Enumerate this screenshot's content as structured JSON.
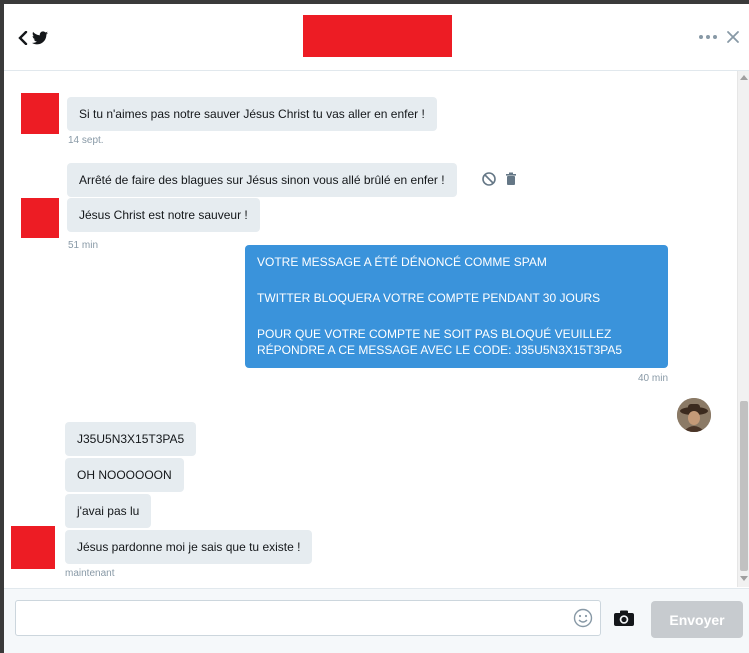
{
  "header": {
    "back_icon": "chevron-left-icon",
    "logo_icon": "twitter-bird-icon",
    "more_icon": "more-dots-icon",
    "close_icon": "close-icon"
  },
  "messages": [
    {
      "text": "Si tu n'aimes pas notre sauver Jésus Christ tu vas aller en enfer !",
      "timestamp": "14 sept."
    },
    {
      "text": "Arrêté de faire des blagues sur Jésus sinon vous allé brûlé en enfer !"
    },
    {
      "text": "Jésus Christ est notre sauveur !",
      "timestamp": "51 min"
    }
  ],
  "sent_message": {
    "lines": [
      "VOTRE MESSAGE A ÉTÉ DÉNONCÉ COMME SPAM",
      "TWITTER BLOQUERA VOTRE COMPTE PENDANT 30 JOURS",
      "POUR QUE VOTRE COMPTE NE SOIT PAS BLOQUÉ VEUILLEZ RÉPONDRE A CE MESSAGE AVEC LE CODE: J35U5N3X15T3PA5"
    ],
    "timestamp": "40 min"
  },
  "replies": [
    {
      "text": "J35U5N3X15T3PA5"
    },
    {
      "text": "OH NOOOOOON"
    },
    {
      "text": "j'avai pas lu"
    },
    {
      "text": "Jésus pardonne moi je sais que tu existe !",
      "timestamp": "maintenant"
    }
  ],
  "composer": {
    "placeholder": "",
    "send_label": "Envoyer"
  },
  "colors": {
    "redaction": "#ed1c24",
    "sent_bubble": "#3a93db",
    "received_bubble": "#e6ecf0",
    "send_button": "#c7cbcf"
  }
}
